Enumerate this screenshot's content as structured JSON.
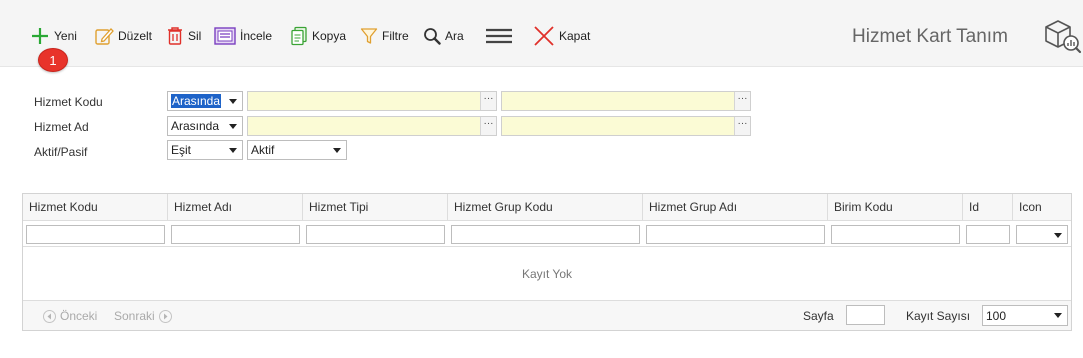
{
  "toolbar": {
    "new_label": "Yeni",
    "edit_label": "Düzelt",
    "delete_label": "Sil",
    "inspect_label": "İncele",
    "copy_label": "Kopya",
    "filter_label": "Filtre",
    "search_label": "Ara",
    "close_label": "Kapat",
    "badge_count": "1"
  },
  "page": {
    "title": "Hizmet Kart Tanım"
  },
  "filters": {
    "rows": [
      {
        "label": "Hizmet Kodu",
        "operator": "Arasında",
        "value1": "",
        "value2": ""
      },
      {
        "label": "Hizmet Ad",
        "operator": "Arasında",
        "value1": "",
        "value2": ""
      },
      {
        "label": "Aktif/Pasif",
        "operator": "Eşit",
        "value": "Aktif"
      }
    ]
  },
  "grid": {
    "columns": [
      "Hizmet Kodu",
      "Hizmet Adı",
      "Hizmet Tipi",
      "Hizmet Grup Kodu",
      "Hizmet Grup Adı",
      "Birim Kodu",
      "Id",
      "Icon"
    ],
    "empty_text": "Kayıt Yok",
    "pager": {
      "prev_label": "Önceki",
      "next_label": "Sonraki",
      "page_label": "Sayfa",
      "page_value": "",
      "count_label": "Kayıt Sayısı",
      "count_value": "100"
    }
  },
  "colors": {
    "accent_green": "#2aa835",
    "badge_red": "#e8332a",
    "close_red": "#e0302a",
    "input_yellow": "#fbfbd5",
    "select_highlight": "#1e63c8"
  }
}
